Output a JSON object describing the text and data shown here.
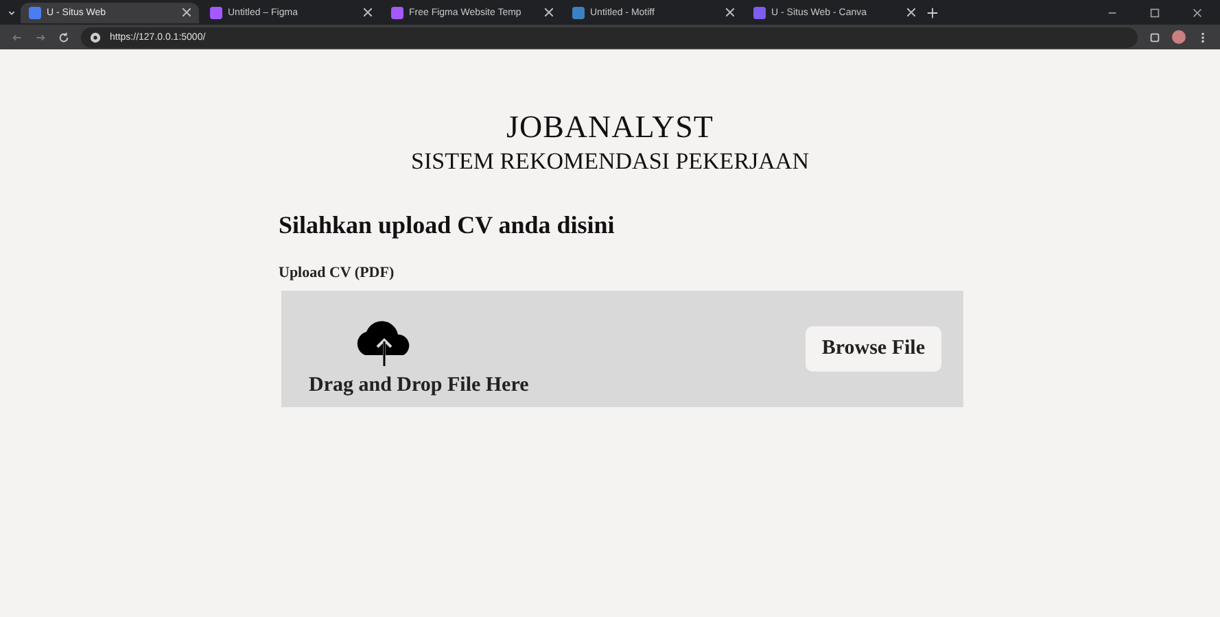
{
  "browser": {
    "tabs": [
      {
        "title": "U - Situs Web",
        "selected": true,
        "color": "#4a7df0"
      },
      {
        "title": "Untitled – Figma",
        "selected": false,
        "color": "#a259ff"
      },
      {
        "title": "Free Figma Website Temp",
        "selected": false,
        "color": "#a259ff"
      },
      {
        "title": "Untitled - Motiff",
        "selected": false,
        "color": "#3b82c4"
      },
      {
        "title": "U - Situs Web - Canva",
        "selected": false,
        "color": "#7d5cf0"
      }
    ],
    "url": "https://127.0.0.1:5000/"
  },
  "page": {
    "title": "JOBANALYST",
    "subtitle": "SISTEM REKOMENDASI PEKERJAAN",
    "heading": "Silahkan upload CV anda disini",
    "upload": {
      "label": "Upload CV (PDF)",
      "drop_text": "Drag and Drop File Here",
      "button": "Browse File"
    }
  }
}
